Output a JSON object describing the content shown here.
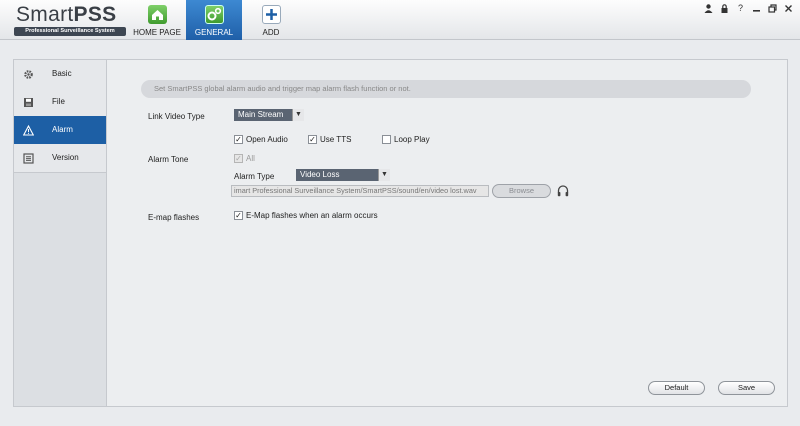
{
  "app": {
    "logo_main": "Smart",
    "logo_bold": "PSS",
    "logo_sub": "Professional Surveillance System"
  },
  "nav": {
    "home": "HOME PAGE",
    "general": "GENERAL",
    "add": "ADD"
  },
  "window_controls": [
    "user-icon",
    "lock-icon",
    "help-icon",
    "minimize-icon",
    "restore-icon",
    "close-icon"
  ],
  "sidebar": {
    "items": [
      {
        "label": "Basic",
        "icon": "gear-icon"
      },
      {
        "label": "File",
        "icon": "save-icon"
      },
      {
        "label": "Alarm",
        "icon": "warning-icon",
        "active": true
      },
      {
        "label": "Version",
        "icon": "list-icon"
      }
    ]
  },
  "notice": "Set SmartPSS global alarm audio and trigger map alarm flash function or not.",
  "link_video": {
    "label": "Link Video Type",
    "value": "Main Stream"
  },
  "audio_opts": {
    "open_audio": {
      "label": "Open Audio",
      "checked": true
    },
    "use_tts": {
      "label": "Use TTS",
      "checked": true
    },
    "loop_play": {
      "label": "Loop Play",
      "checked": false
    }
  },
  "alarm_tone": {
    "label": "Alarm Tone",
    "all_label": "All",
    "type_label": "Alarm Type",
    "type_value": "Video Loss",
    "path": "imart Professional Surveillance System/SmartPSS/sound/en/video lost.wav",
    "browse": "Browse"
  },
  "emap": {
    "label": "E-map flashes",
    "option": "E-Map flashes when an alarm occurs",
    "checked": true
  },
  "buttons": {
    "default": "Default",
    "save": "Save"
  },
  "colors": {
    "accent": "#1d5fa5",
    "dropdown": "#5a6472",
    "green_icon": "#4caf3a"
  }
}
